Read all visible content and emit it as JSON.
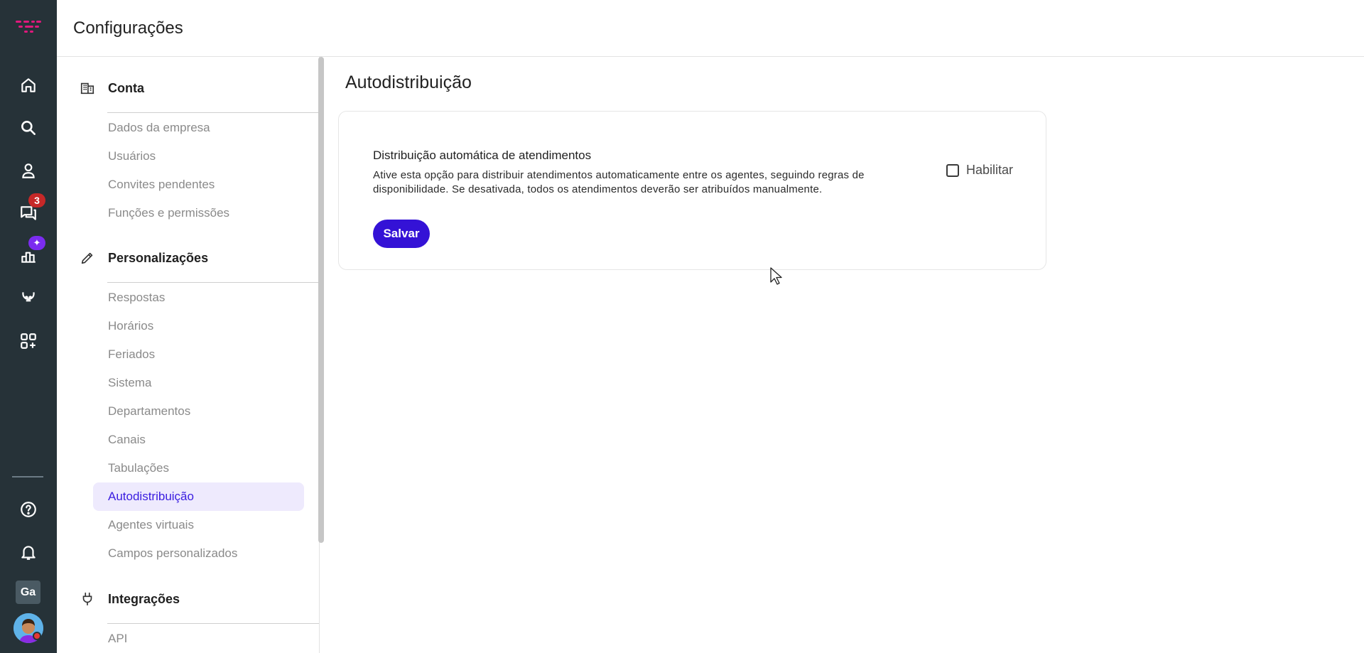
{
  "rail": {
    "logo": "brand-logo",
    "items": [
      {
        "icon": "home-icon"
      },
      {
        "icon": "search-icon"
      },
      {
        "icon": "contacts-icon"
      },
      {
        "icon": "chat-icon",
        "badge": "3"
      },
      {
        "icon": "reports-icon",
        "badge": "✦"
      },
      {
        "icon": "bot-icon"
      },
      {
        "icon": "apps-add-icon"
      }
    ],
    "bottom": [
      {
        "icon": "help-icon"
      },
      {
        "icon": "bell-icon"
      }
    ],
    "initials": "Ga"
  },
  "header": {
    "title": "Configurações"
  },
  "menu": {
    "sections": [
      {
        "title": "Conta",
        "icon": "building-icon",
        "items": [
          "Dados da empresa",
          "Usuários",
          "Convites pendentes",
          "Funções e permissões"
        ]
      },
      {
        "title": "Personalizações",
        "icon": "pencil-icon",
        "items": [
          "Respostas",
          "Horários",
          "Feriados",
          "Sistema",
          "Departamentos",
          "Canais",
          "Tabulações",
          "Autodistribuição",
          "Agentes virtuais",
          "Campos personalizados"
        ],
        "active_item": "Autodistribuição"
      },
      {
        "title": "Integrações",
        "icon": "plug-icon",
        "items": [
          "API"
        ]
      }
    ]
  },
  "main": {
    "title": "Autodistribuição",
    "card": {
      "title": "Distribuição automática de atendimentos",
      "description": "Ative esta opção para distribuir atendimentos automaticamente entre os agentes, seguindo regras de disponibilidade. Se desativada, todos os atendimentos deverão ser atribuídos manualmente.",
      "checkbox_label": "Habilitar",
      "checkbox_checked": false,
      "save_label": "Salvar"
    }
  },
  "colors": {
    "rail_bg": "#263238",
    "accent": "#3412d6",
    "active_bg": "#eeeafd",
    "logo": "#e0197d"
  }
}
